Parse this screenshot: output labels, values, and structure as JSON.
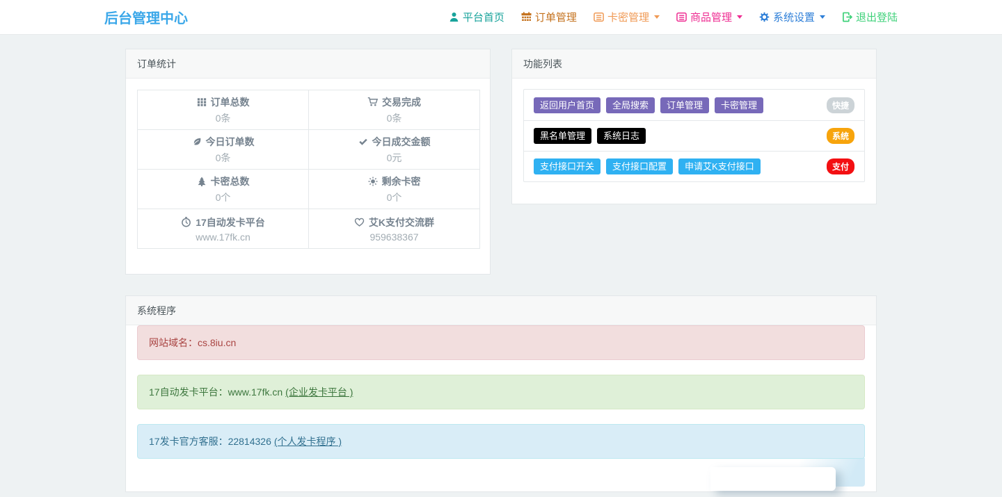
{
  "navbar": {
    "brand": "后台管理中心",
    "items": [
      {
        "label": "平台首页",
        "icon": "user-icon",
        "color": "#18a39b",
        "caret": false
      },
      {
        "label": "订单管理",
        "icon": "calendar-icon",
        "color": "#c4711c",
        "caret": false
      },
      {
        "label": "卡密管理",
        "icon": "list-alt-icon",
        "color": "#f09a55",
        "caret": true
      },
      {
        "label": "商品管理",
        "icon": "list-alt-icon",
        "color": "#ee2d92",
        "caret": true
      },
      {
        "label": "系统设置",
        "icon": "gear-icon",
        "color": "#2e7fd8",
        "caret": true
      },
      {
        "label": "退出登陆",
        "icon": "logout-icon",
        "color": "#3ed179",
        "caret": false
      }
    ]
  },
  "order_stats": {
    "title": "订单统计",
    "cells": [
      {
        "icon": "grid-icon",
        "label": "订单总数",
        "value": "0条"
      },
      {
        "icon": "cart-icon",
        "label": "交易完成",
        "value": "0条"
      },
      {
        "icon": "leaf-icon",
        "label": "今日订单数",
        "value": "0条"
      },
      {
        "icon": "check-icon",
        "label": "今日成交金额",
        "value": "0元"
      },
      {
        "icon": "tree-icon",
        "label": "卡密总数",
        "value": "0个"
      },
      {
        "icon": "sun-icon",
        "label": "剩余卡密",
        "value": "0个"
      },
      {
        "icon": "clock-icon",
        "label": "17自动发卡平台",
        "value": "www.17fk.cn"
      },
      {
        "icon": "heart-icon",
        "label": "艾K支付交流群",
        "value": "959638367"
      }
    ]
  },
  "function_list": {
    "title": "功能列表",
    "rows": [
      {
        "button_color": "#7769b9",
        "buttons": [
          "返回用户首页",
          "全局搜索",
          "订单管理",
          "卡密管理"
        ],
        "badge": {
          "label": "快捷",
          "color": "#ccd3d7"
        }
      },
      {
        "button_color": "#000000",
        "buttons": [
          "黑名单管理",
          "系统日志"
        ],
        "badge": {
          "label": "系统",
          "color": "#f7a40c"
        }
      },
      {
        "button_color": "#2fb1f2",
        "buttons": [
          "支付接口开关",
          "支付接口配置",
          "申请艾K支付接口"
        ],
        "badge": {
          "label": "支付",
          "color": "#f30f12"
        }
      }
    ]
  },
  "system_program": {
    "title": "系统程序",
    "alerts": [
      {
        "type": "danger",
        "text": "网站域名：cs.8iu.cn",
        "link": ""
      },
      {
        "type": "success",
        "text": "17自动发卡平台：www.17fk.cn",
        "link": "(企业发卡平台 )"
      },
      {
        "type": "info",
        "text": "17发卡官方客服：22814326",
        "link": "(个人发卡程序 )"
      }
    ]
  }
}
